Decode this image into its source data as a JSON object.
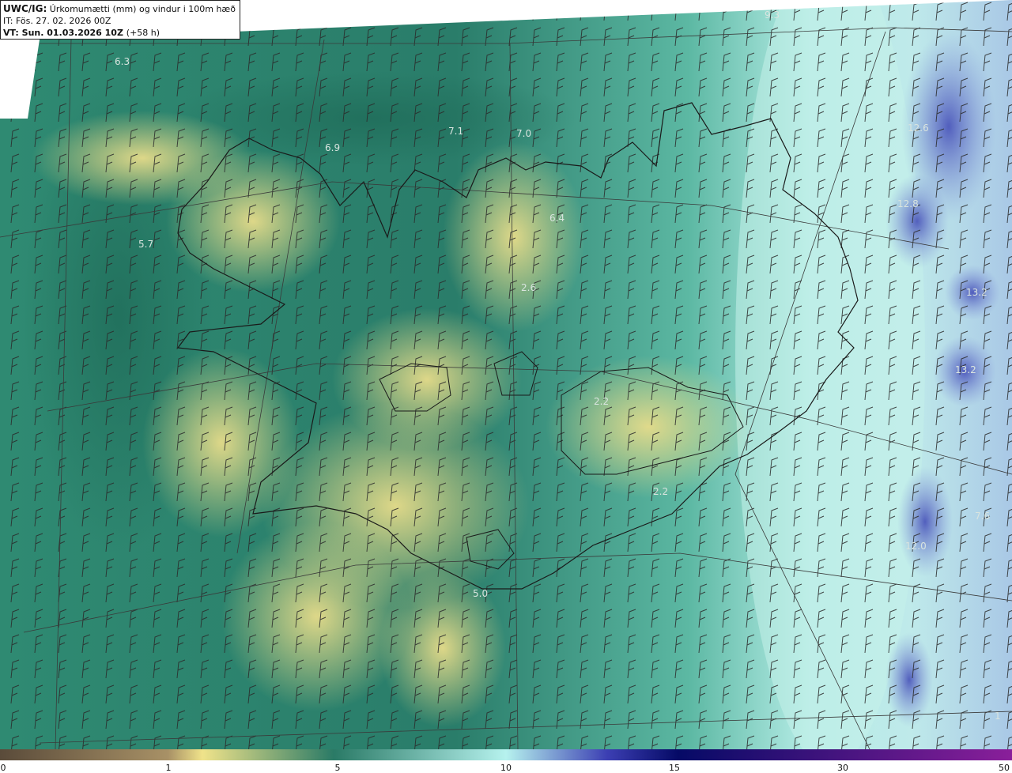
{
  "header": {
    "brand": "UWC/IG:",
    "title": "Úrkomumætti (mm) og vindur i 100m hæð",
    "init_time": "IT: Fös. 27. 02. 2026 00Z",
    "valid_time": "VT: Sun. 01.03.2026 10Z",
    "lead": "(+58 h)"
  },
  "labels": [
    {
      "text": "6.3"
    },
    {
      "text": "6.9"
    },
    {
      "text": "7.1"
    },
    {
      "text": "7.0"
    },
    {
      "text": "9.3"
    },
    {
      "text": "12.6"
    },
    {
      "text": "12.8"
    },
    {
      "text": "6.4"
    },
    {
      "text": "5.7"
    },
    {
      "text": "2.6"
    },
    {
      "text": "13.2"
    },
    {
      "text": "13.2"
    },
    {
      "text": "2.2"
    },
    {
      "text": "2.2"
    },
    {
      "text": "7.6"
    },
    {
      "text": "12.0"
    },
    {
      "text": "5.0"
    },
    {
      "text": "1"
    }
  ],
  "colorbar": {
    "ticks": [
      "0",
      "1",
      "5",
      "10",
      "15",
      "30",
      "50"
    ],
    "colors": [
      "#5a4b3a",
      "#a89166",
      "#f0e38a",
      "#2a7a66",
      "#b6f2ee",
      "#3c3fb3",
      "#050a66",
      "#8a1f9a"
    ]
  }
}
